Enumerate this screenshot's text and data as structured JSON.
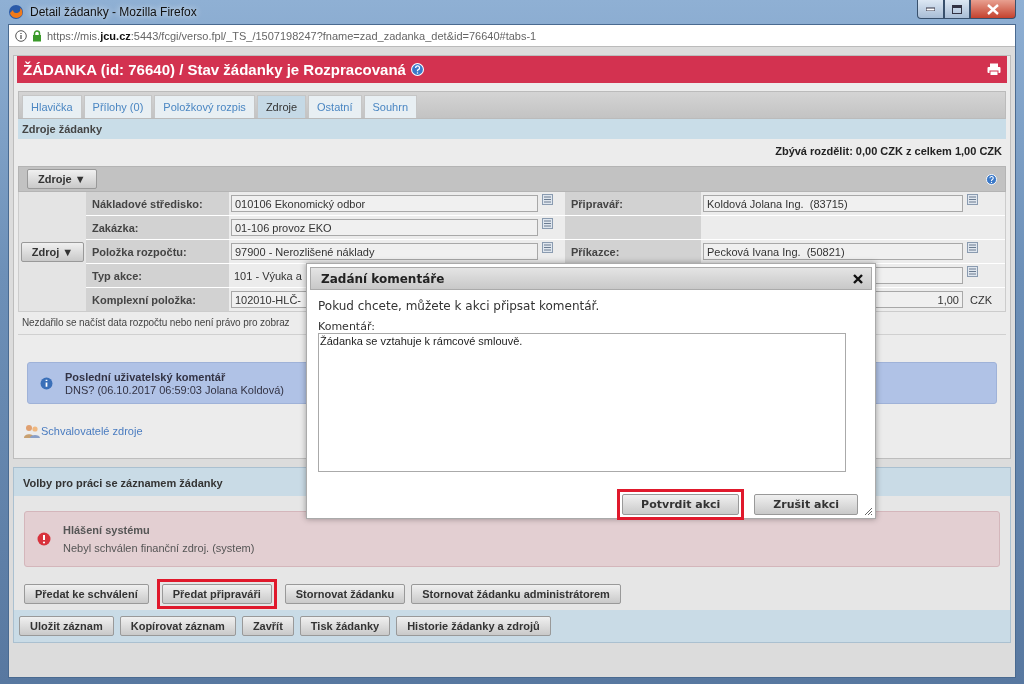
{
  "window": {
    "title": "Detail žádanky - Mozilla Firefox"
  },
  "address_bar": {
    "url": "https://mis.**jcu.cz**:5443/fcgi/verso.fpl/_TS_/1507198247?fname=zad_zadanka_det&id=76640#tabs-1"
  },
  "header": {
    "title": "ŽÁDANKA (id: 76640) / Stav žádanky je Rozpracovaná"
  },
  "tabs": [
    {
      "label": "Hlavička",
      "selected": false
    },
    {
      "label": "Přílohy (0)",
      "selected": false
    },
    {
      "label": "Položkový rozpis",
      "selected": false
    },
    {
      "label": "Zdroje",
      "selected": true
    },
    {
      "label": "Ostatní",
      "selected": false
    },
    {
      "label": "Souhrn",
      "selected": false
    }
  ],
  "section": {
    "title": "Zdroje žádanky",
    "summary": "Zbývá rozdělit: 0,00 CZK z celkem 1,00 CZK",
    "toolbar_button": "Zdroje ▼"
  },
  "form": {
    "source_button": "Zdroj ▼",
    "rows": [
      {
        "label": "Nákladové středisko:",
        "value": "010106 Ekonomický odbor",
        "picker": true,
        "right": {
          "label": "Připravář:",
          "value": "Koldová Jolana Ing.  (83715)",
          "picker": true
        }
      },
      {
        "label": "Zakázka:",
        "value": "01-106 provoz EKO",
        "picker": true,
        "right": {
          "kind": "blank"
        }
      },
      {
        "label": "Položka rozpočtu:",
        "value": "97900 - Nerozlišené náklady",
        "picker": true,
        "right": {
          "label": "Příkazce:",
          "value": "Pecková Ivana Ing.  (50821)",
          "picker": true
        }
      },
      {
        "label": "Typ akce:",
        "value": "101 - Výuka a",
        "kind": "text",
        "right": {
          "picker": true
        }
      },
      {
        "label": "Komplexní položka:",
        "value": "102010-HLČ-",
        "right": {
          "value": "1,00",
          "unit": "CZK"
        }
      }
    ]
  },
  "budget_message": "Nezdařilo se načíst data rozpočtu nebo není právo pro zobraz",
  "last_comment": {
    "title": "Poslední uživatelský komentář",
    "text": "DNS? (06.10.2017 06:59:03 Jolana Koldová)"
  },
  "approvers_link": "Schvalovatelé zdroje",
  "options": {
    "title": "Volby pro práci se záznamem žádanky",
    "system_message": {
      "title": "Hlášení systému",
      "text": "Nebyl schválen finanční zdroj. (system)"
    },
    "actions": [
      {
        "label": "Předat ke schválení",
        "highlighted": false
      },
      {
        "label": "Předat připraváři",
        "highlighted": true
      },
      {
        "label": "Stornovat žádanku",
        "highlighted": false
      },
      {
        "label": "Stornovat žádanku administrátorem",
        "highlighted": false
      }
    ],
    "record_buttons": [
      {
        "label": "Uložit záznam"
      },
      {
        "label": "Kopírovat záznam"
      },
      {
        "label": "Zavřít"
      },
      {
        "label": "Tisk žádanky"
      },
      {
        "label": "Historie žádanky a zdrojů"
      }
    ]
  },
  "dialog": {
    "title": "Zadání komentáře",
    "message": "Pokud chcete, můžete k akci připsat komentář.",
    "comment_label": "Komentář:",
    "comment": "Žádanka se vztahuje k rámcové smlouvě.",
    "buttons": [
      {
        "label": "Potvrdit akci",
        "highlighted": true
      },
      {
        "label": "Zrušit akci",
        "highlighted": false
      }
    ]
  }
}
